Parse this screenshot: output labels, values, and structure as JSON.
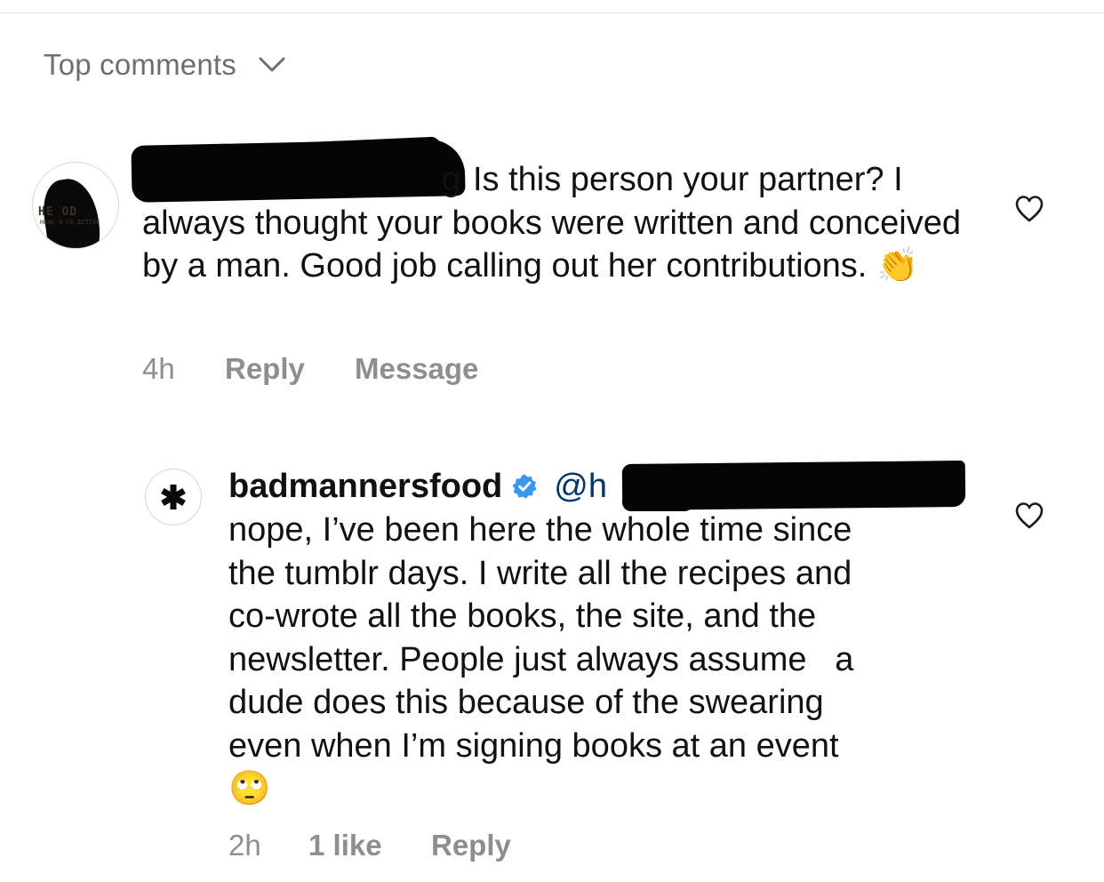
{
  "header": {
    "sort_label": "Top comments",
    "sort_icon": "chevron-down-icon"
  },
  "comments": [
    {
      "avatar_logo_line1": "HE    OD",
      "avatar_logo_line2": "HEAL  G CO  ECTIVE",
      "username_visible_fragment": "g",
      "text": "Is this person your partner? I always thought your books were written and conceived by a man. Good job calling out her contributions.",
      "emoji": "👏",
      "emoji_name": "clapping-hands-icon",
      "time": "4h",
      "reply_label": "Reply",
      "message_label": "Message",
      "like_icon": "heart-outline-icon"
    },
    {
      "username": "badmannersfood",
      "verified_icon": "verified-badge-icon",
      "mention_visible": "@h",
      "lines": [
        "nope, I’ve been here the whole time since",
        "the tumblr days. I write all the recipes and",
        "co-wrote all the books, the site, and the",
        "newsletter. People just always assume   a",
        "dude does this because of the swearing",
        "even when I’m signing books at an event"
      ],
      "emoji": "🙄",
      "emoji_name": "eye-roll-face-icon",
      "time": "2h",
      "likes_label": "1 like",
      "reply_label": "Reply",
      "like_icon": "heart-outline-icon"
    }
  ],
  "colors": {
    "primary_text": "#111111",
    "secondary_text": "#8e8e8e",
    "header_text": "#6e6e6e",
    "mention": "#00376b",
    "verified_blue": "#3897f0",
    "redaction": "#050505"
  }
}
